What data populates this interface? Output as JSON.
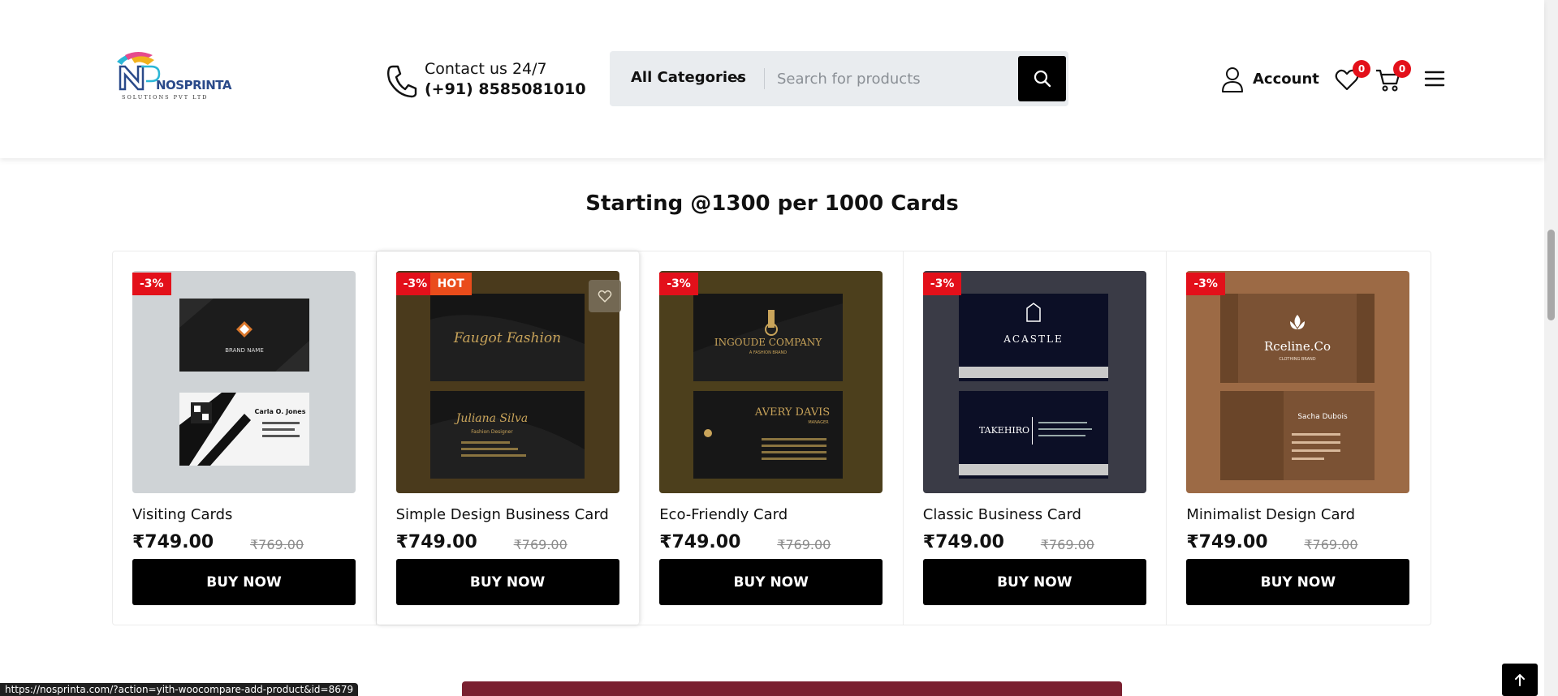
{
  "header": {
    "logo_text": "NOSPRINTA",
    "logo_subtext": "SOLUTIONS PVT LTD",
    "contact_label": "Contact us 24/7",
    "contact_phone": "(+91) 8585081010",
    "search": {
      "category_label": "All Categories",
      "placeholder": "Search for products"
    },
    "account_label": "Account",
    "wishlist_count": "0",
    "cart_count": "0"
  },
  "section": {
    "title": "Starting @1300 per 1000 Cards"
  },
  "products": [
    {
      "name": "Visiting Cards",
      "discount": "-3%",
      "price": "₹749.00",
      "old_price": "₹769.00",
      "button": "BUY NOW"
    },
    {
      "name": "Simple Design Business Card",
      "discount": "-3%",
      "hot": "HOT",
      "price": "₹749.00",
      "old_price": "₹769.00",
      "button": "BUY NOW"
    },
    {
      "name": "Eco-Friendly Card",
      "discount": "-3%",
      "price": "₹749.00",
      "old_price": "₹769.00",
      "button": "BUY NOW"
    },
    {
      "name": "Classic Business Card",
      "discount": "-3%",
      "price": "₹749.00",
      "old_price": "₹769.00",
      "button": "BUY NOW"
    },
    {
      "name": "Minimalist Design Card",
      "discount": "-3%",
      "price": "₹749.00",
      "old_price": "₹769.00",
      "button": "BUY NOW"
    }
  ],
  "card_texts": {
    "c1_brand": "BRAND NAME",
    "c1_name": "Carla O. Jones",
    "c2_front": "Faugot Fashion",
    "c2_back": "Juliana Silva",
    "c2_role": "Fashion Designer",
    "c3_front": "INGOUDE COMPANY",
    "c3_tag": "A FASHION BRAND",
    "c3_back": "AVERY DAVIS",
    "c3_role": "MANAGER",
    "c4_front": "ACASTLE",
    "c4_back": "TAKEHIRO",
    "c5_front": "Rceline.Co",
    "c5_tag": "CLOTHING BRAND",
    "c5_back": "Sacha Dubois"
  },
  "status_bar_url": "https://nosprinta.com/?action=yith-woocompare-add-product&id=8679",
  "colors": {
    "discount": "#e3101a",
    "hot": "#ea4c1b",
    "button": "#000000",
    "banner": "#7a2030"
  }
}
